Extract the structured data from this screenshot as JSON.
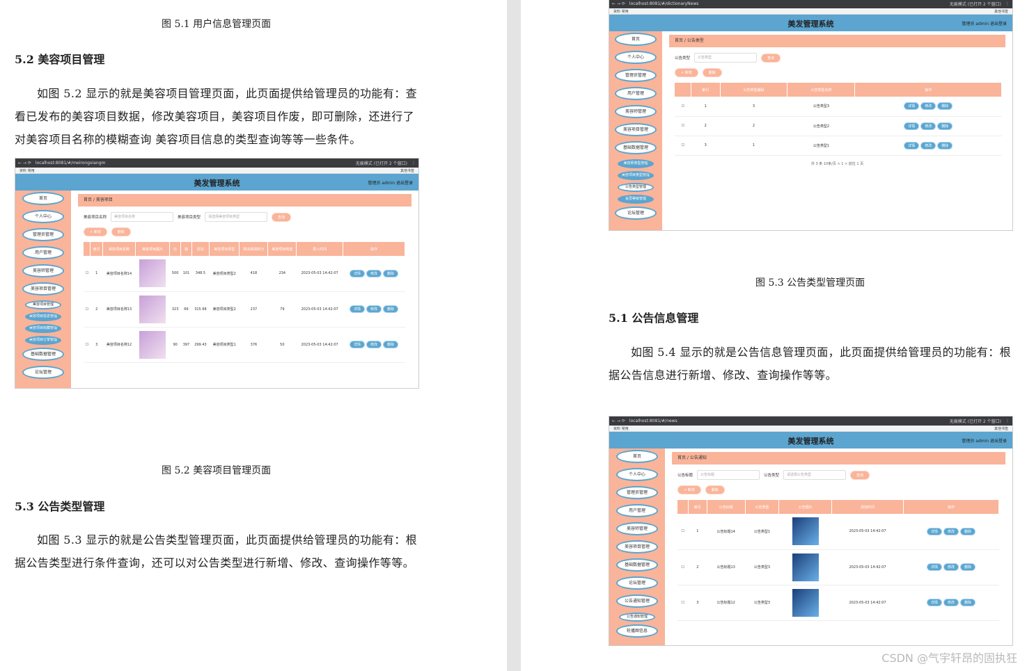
{
  "page_left": {
    "fig51_caption": "图 5.1  用户信息管理页面",
    "sec52_heading": "5.2  美容项目管理",
    "sec52_para": "如图 5.2 显示的就是美容项目管理页面，此页面提供给管理员的功能有：查看已发布的美容项目数据，修改美容项目，美容项目作废，即可删除，还进行了对美容项目名称的模糊查询  美容项目信息的类型查询等等一些条件。",
    "fig52_caption": "图 5.2  美容项目管理页面",
    "sec53_heading": "5.3 公告类型管理",
    "sec53_para": "如图 5.3 显示的就是公告类型管理页面，此页面提供给管理员的功能有：根据公告类型进行条件查询，还可以对公告类型进行新增、修改、查询操作等等。"
  },
  "page_right": {
    "fig53_caption": "图 5.3  公告类型管理页面",
    "sec51_heading": "5.1 公告信息管理",
    "sec51_para": "如图 5.4 显示的就是公告信息管理页面，此页面提供给管理员的功能有：根据公告信息进行新增、修改、查询操作等等。",
    "watermark": "CSDN @气宇轩昂的固执狂"
  },
  "common": {
    "app_title": "美发管理系统",
    "user_info": "管理员 admin    退出登录",
    "bookmarks": "资料    常用",
    "bookmarks_right": "其他书签",
    "browser_status": "无痕模式 (已打开 2 个窗口)",
    "crumb_home": "首页",
    "btn_add": "+ 新增",
    "btn_delete": "删除",
    "btn_search": "查询",
    "btn_detail": "详情",
    "btn_edit": "修改",
    "btn_remove": "删除",
    "menu": [
      "首页",
      "个人中心",
      "管理员管理",
      "用户管理",
      "美容师管理",
      "美容项目管理",
      "基础数据管理",
      "论坛管理"
    ]
  },
  "shot1": {
    "url": "localhost:8081/#/meirongxiangm",
    "crumb": "美容项目",
    "search_name_label": "美容项目名称",
    "search_name_ph": "美容项目名称",
    "search_type_label": "美容项目类型",
    "search_type_ph": "请选择美容项目类型",
    "submenu": [
      "美容项目管理",
      "美容项目信息管理",
      "美容项目收藏管理",
      "美容项目订单管理"
    ],
    "headers": [
      "",
      "索引",
      "美容项目名称",
      "美容项目图片",
      "价",
      "销",
      "折扣",
      "美容项目类型",
      "购买获得积分",
      "美容项目热度",
      "录入时间",
      "操作"
    ],
    "rows": [
      [
        "1",
        "美容项目名称14",
        "500",
        "101",
        "348.5",
        "美容项目类型2",
        "418",
        "234",
        "2023-05-03 14:42:07"
      ],
      [
        "2",
        "美容项目名称13",
        "323",
        "66",
        "315.68",
        "美容项目类型2",
        "237",
        "79",
        "2023-05-03 14:42:07"
      ],
      [
        "3",
        "美容项目名称12",
        "90",
        "397",
        "299.43",
        "美容项目类型1",
        "376",
        "50",
        "2023-05-03 14:42:07"
      ]
    ]
  },
  "shot2": {
    "url": "localhost:8081/#/dictionaryNews",
    "crumb": "公告类型",
    "search_label": "公告类型",
    "search_ph": "公告类型",
    "submenu": [
      "美容师类型管理",
      "美容项目类型管理",
      "公告类型管理",
      "会员等级管理"
    ],
    "headers": [
      "",
      "索引",
      "公告类型编码",
      "公告类型名称",
      "操作"
    ],
    "rows": [
      [
        "1",
        "3",
        "公告类型3"
      ],
      [
        "2",
        "2",
        "公告类型2"
      ],
      [
        "3",
        "1",
        "公告类型1"
      ]
    ],
    "pager": "共 3 条    10条/页    <   1   >    前往   1   页"
  },
  "shot3": {
    "url": "localhost:8081/#/news",
    "crumb": "公告通知",
    "search_title_label": "公告标题",
    "search_title_ph": "公告标题",
    "search_type_label": "公告类型",
    "search_type_ph": "请选择公告类型",
    "submenu": [
      "公告通知管理",
      "轮播图信息"
    ],
    "headers": [
      "",
      "索引",
      "公告标题",
      "公告类型",
      "公告图片",
      "添加时间",
      "操作"
    ],
    "rows": [
      [
        "1",
        "公告标题14",
        "公告类型1",
        "2023-05-03 14:42:07"
      ],
      [
        "2",
        "公告标题13",
        "公告类型3",
        "2023-05-03 14:42:07"
      ],
      [
        "3",
        "公告标题12",
        "公告类型3",
        "2023-05-03 14:42:07"
      ]
    ]
  }
}
